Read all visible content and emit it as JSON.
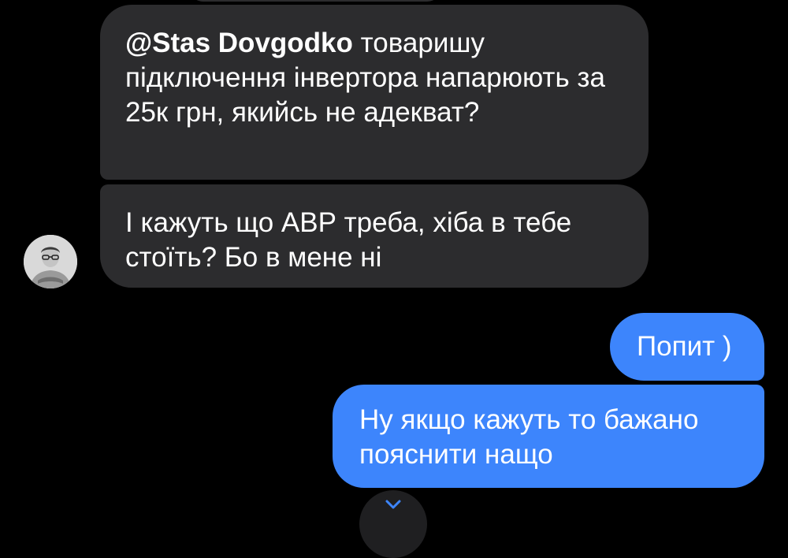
{
  "chat": {
    "messages": [
      {
        "direction": "incoming",
        "mention": "@Stas Dovgodko",
        "text": " товаришу підключення інвертора напарюють за 25к грн, якийсь не адекват?"
      },
      {
        "direction": "incoming",
        "text": "І кажуть що АВР треба, хіба в тебе стоїть? Бо в мене ні"
      },
      {
        "direction": "outgoing",
        "text": "Попит )"
      },
      {
        "direction": "outgoing",
        "text": "Ну якщо кажуть то бажано пояснити нащо"
      }
    ],
    "sender_avatar_icon": "user-avatar",
    "scroll_icon": "chevron-down-icon"
  },
  "colors": {
    "background": "#000000",
    "incoming_bubble": "#2c2c2e",
    "outgoing_bubble": "#3d85fc",
    "text": "#ffffff"
  }
}
